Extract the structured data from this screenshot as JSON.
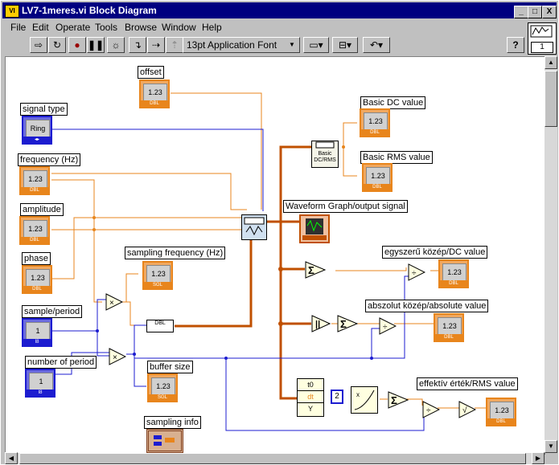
{
  "window": {
    "title": "LV7-1meres.vi Block Diagram",
    "title_icon": "vi-icon",
    "controls": [
      "_",
      "□",
      "X"
    ]
  },
  "menu": [
    "File",
    "Edit",
    "Operate",
    "Tools",
    "Browse",
    "Window",
    "Help"
  ],
  "toolbar": {
    "font_selector": "13pt Application Font",
    "help_label": "?"
  },
  "connector_pane": {
    "number": "1"
  },
  "labels": {
    "offset": "offset",
    "signal_type": "signal type",
    "frequency": "frequency (Hz)",
    "amplitude": "amplitude",
    "phase": "phase",
    "sample_period": "sample/period",
    "number_of_period": "number of period",
    "sampling_frequency": "sampling frequency  (Hz)",
    "buffer_size": "buffer size",
    "sampling_info": "sampling info",
    "basic_dc": "Basic DC value",
    "basic_rms": "Basic RMS value",
    "waveform_graph": "Waveform Graph/output signal",
    "egyszeru": "egyszerű közép/DC value",
    "abszolut": "abszolut közép/absolute value",
    "effektiv": "effektív érték/RMS value"
  },
  "terminals": {
    "num": "1.23",
    "ring": "Ring",
    "int_val": "1",
    "dbl": "DBL",
    "sgl": "SGL",
    "i8": "I8",
    "const_two": "2",
    "basic_node": "Basic DC/RMS",
    "dbl_conv": "DBL",
    "t0": "t0",
    "dt": "dt",
    "y": "Y"
  },
  "colors": {
    "orange": "#e8851c",
    "blue": "#1c1cd0",
    "brown": "#c05000",
    "titlebar": "#000080"
  }
}
